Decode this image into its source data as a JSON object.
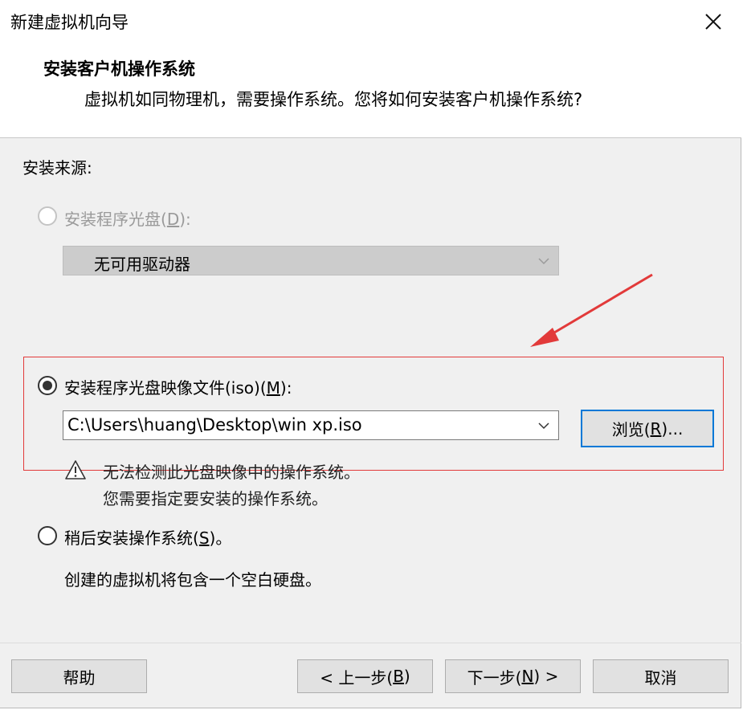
{
  "window": {
    "title": "新建虚拟机向导"
  },
  "header": {
    "title": "安装客户机操作系统",
    "description": "虚拟机如同物理机，需要操作系统。您将如何安装客户机操作系统?"
  },
  "install_source": {
    "label": "安装来源:",
    "disc": {
      "label_pre": "安装程序光盘(",
      "accel": "D",
      "label_post": "):",
      "selected": false,
      "enabled": false,
      "drive_value": "无可用驱动器"
    },
    "iso": {
      "label_pre": "安装程序光盘映像文件(iso)(",
      "accel": "M",
      "label_post": "):",
      "selected": true,
      "path": "C:\\Users\\huang\\Desktop\\win xp.iso",
      "browse_pre": "浏览(",
      "browse_accel": "R",
      "browse_post": ")...",
      "warning_line1": "无法检测此光盘映像中的操作系统。",
      "warning_line2": "您需要指定要安装的操作系统。"
    },
    "later": {
      "label_pre": "稍后安装操作系统(",
      "accel": "S",
      "label_post": ")。",
      "selected": false,
      "description": "创建的虚拟机将包含一个空白硬盘。"
    }
  },
  "footer": {
    "help": "帮助",
    "back_pre": "< 上一步(",
    "back_accel": "B",
    "back_post": ")",
    "next_pre": "下一步(",
    "next_accel": "N",
    "next_post": ") >",
    "cancel": "取消"
  },
  "colors": {
    "highlight_box": "#e23a3a",
    "focus_border": "#0078d7"
  }
}
